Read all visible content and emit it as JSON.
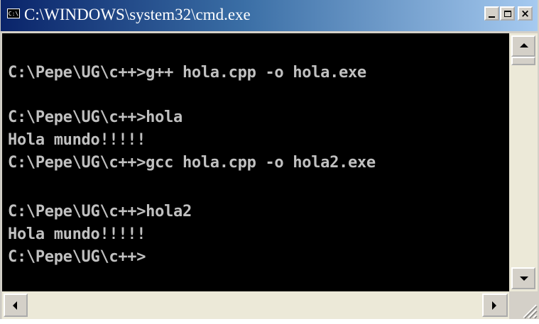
{
  "window": {
    "title": "C:\\WINDOWS\\system32\\cmd.exe",
    "icon": "console-icon",
    "icon_text": "C:\\",
    "controls": {
      "minimize": "minimize-icon",
      "maximize": "maximize-icon",
      "close": "close-icon",
      "close_glyph": "×"
    }
  },
  "console": {
    "background": "#000000",
    "foreground": "#c0c0c0",
    "lines": [
      "",
      "C:\\Pepe\\UG\\c++>g++ hola.cpp -o hola.exe",
      "",
      "C:\\Pepe\\UG\\c++>hola",
      "Hola mundo!!!!!",
      "C:\\Pepe\\UG\\c++>gcc hola.cpp -o hola2.exe",
      "",
      "C:\\Pepe\\UG\\c++>hola2",
      "Hola mundo!!!!!",
      "C:\\Pepe\\UG\\c++>"
    ]
  },
  "scrollbars": {
    "vertical": {
      "up": "scroll-up-icon",
      "down": "scroll-down-icon"
    },
    "horizontal": {
      "left": "scroll-left-icon",
      "right": "scroll-right-icon"
    }
  },
  "colors": {
    "titlebar_start": "#0a246a",
    "titlebar_end": "#a6caf0",
    "chrome": "#d4d0c8"
  }
}
